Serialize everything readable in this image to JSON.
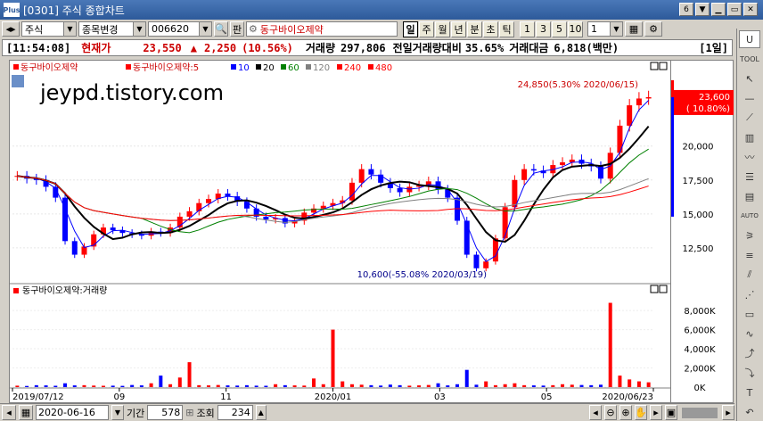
{
  "window": {
    "title": "[0301] 주식 종합차트",
    "logo": "Plus",
    "page_num": "6"
  },
  "toolbar": {
    "market": "주식",
    "mode": "종목변경",
    "code": "006620",
    "lookup": "판",
    "stock_name": "동구바이오제약",
    "periods": [
      "일",
      "주",
      "월",
      "년",
      "분",
      "초",
      "틱"
    ],
    "active_period": "일",
    "nums": [
      "1",
      "3",
      "5",
      "10"
    ],
    "count": "1"
  },
  "quote": {
    "time": "[11:54:08]",
    "label_price": "현재가",
    "price": "23,550",
    "arrow": "▲",
    "change": "2,250",
    "change_pct": "(10.56%)",
    "label_volume": "거래량",
    "volume": "297,806",
    "label_prev_ratio": "전일거래량대비",
    "prev_ratio": "35.65%",
    "label_amount": "거래대금",
    "amount": "6,818(백만)",
    "period_tag": "[1일]"
  },
  "watermark": "jeypd.tistory.com",
  "price_panel": {
    "legend_stock": "동구바이오제약",
    "legend_ma_label": "동구바이오제약:5",
    "ma_periods": [
      "10",
      "20",
      "60",
      "120",
      "240",
      "480"
    ],
    "ma_colors": [
      "#0000ff",
      "#000000",
      "#008000",
      "#808080",
      "#ff0000",
      "#ff0000"
    ],
    "max_label": "24,850(5.30% 2020/06/15)",
    "min_label": "10,600(-55.08% 2020/03/19)",
    "current_price_box": "23,600",
    "current_pct_box": "( 10.80%)"
  },
  "volume_panel": {
    "legend": "동구바이오제약:거래량"
  },
  "chart_data": [
    {
      "type": "candlestick",
      "title": "동구바이오제약",
      "x_range": [
        "2019/07/12",
        "2020/06/23"
      ],
      "x_ticks": [
        "2019/07/12",
        "09",
        "11",
        "2020/01",
        "03",
        "05",
        "2020/06/23"
      ],
      "y_ticks": [
        "12,500",
        "15,000",
        "17,500",
        "20,000"
      ],
      "ylim": [
        10000,
        25500
      ],
      "close": [
        17800,
        17600,
        17500,
        17000,
        16200,
        13000,
        12000,
        12600,
        13500,
        14000,
        13800,
        13600,
        13500,
        13400,
        13700,
        13600,
        14000,
        14800,
        15200,
        15800,
        16100,
        16500,
        16300,
        15900,
        15400,
        14800,
        14600,
        14700,
        14300,
        14500,
        15100,
        15400,
        15600,
        15800,
        16000,
        17300,
        18300,
        17900,
        17300,
        16900,
        16600,
        17000,
        17100,
        17400,
        16800,
        16200,
        14500,
        12000,
        11000,
        11500,
        13200,
        15500,
        17500,
        18300,
        18200,
        18000,
        18600,
        18800,
        19000,
        18700,
        18500,
        17600,
        19500,
        21500,
        23000,
        23500,
        23600
      ],
      "events": [
        {
          "label": "24,850(5.30% 2020/06/15)",
          "value": 24850
        },
        {
          "label": "10,600(-55.08% 2020/03/19)",
          "value": 10600
        }
      ]
    },
    {
      "type": "bar",
      "title": "동구바이오제약:거래량",
      "y_ticks": [
        "0K",
        "2,000K",
        "4,000K",
        "6,000K",
        "8,000K"
      ],
      "ylim": [
        0,
        9500
      ],
      "values": [
        150,
        120,
        200,
        180,
        140,
        400,
        180,
        200,
        160,
        140,
        150,
        130,
        220,
        180,
        400,
        1200,
        300,
        1000,
        2600,
        200,
        180,
        220,
        180,
        160,
        200,
        150,
        140,
        300,
        200,
        180,
        160,
        900,
        300,
        6000,
        600,
        300,
        250,
        200,
        160,
        260,
        200,
        150,
        180,
        220,
        400,
        180,
        300,
        1800,
        250,
        600,
        200,
        300,
        400,
        200,
        180,
        160,
        200,
        300,
        250,
        220,
        200,
        250,
        8800,
        1200,
        800,
        600,
        500
      ]
    }
  ],
  "status": {
    "date": "2020-06-16",
    "label_period": "기간",
    "period": "578",
    "label_query": "조회",
    "query_count": "234"
  },
  "right_toolbar": [
    "U",
    "TOOL",
    "AUTO"
  ]
}
